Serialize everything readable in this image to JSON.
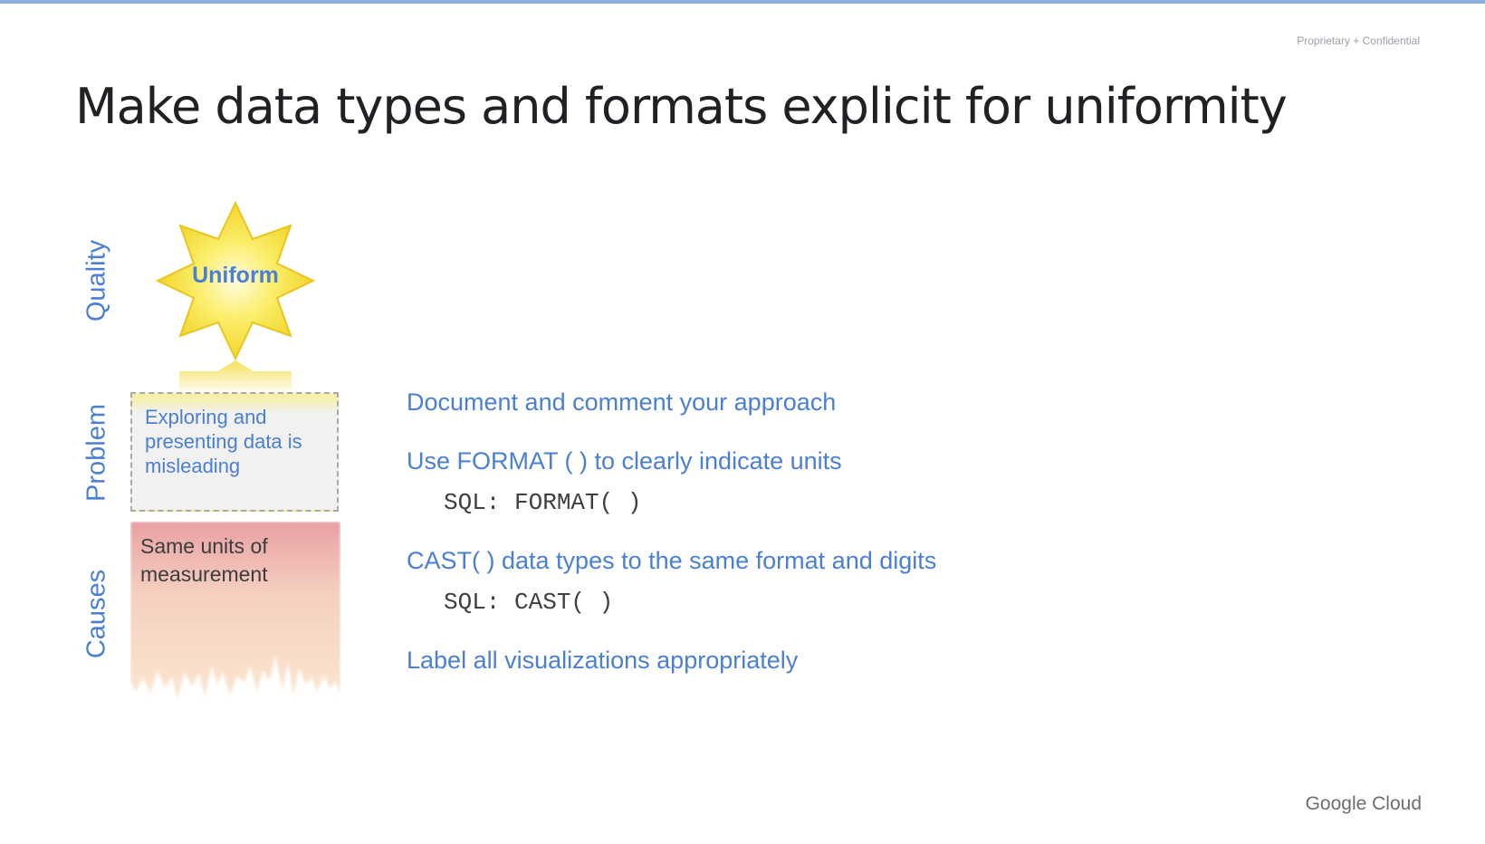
{
  "header": {
    "confidential": "Proprietary + Confidential",
    "title": "Make data types and formats explicit for uniformity"
  },
  "diagram": {
    "quality_label": "Quality",
    "problem_label": "Problem",
    "causes_label": "Causes",
    "sun_text": "Uniform",
    "problem_text": "Exploring and presenting data is misleading",
    "causes_text": "Same units of measurement"
  },
  "items": [
    {
      "text": "Document and comment your approach"
    },
    {
      "text": "Use FORMAT ( ) to clearly indicate units",
      "code": "SQL: FORMAT( )"
    },
    {
      "text": "CAST( ) data types to the same format and digits",
      "code": "SQL: CAST( )"
    },
    {
      "text": "Label all visualizations appropriately"
    }
  ],
  "footer": {
    "brand": "Google Cloud"
  },
  "colors": {
    "accent_blue": "#4a7fd4",
    "sun_yellow": "#f7e23b",
    "top_bar": "#8eaee0"
  }
}
